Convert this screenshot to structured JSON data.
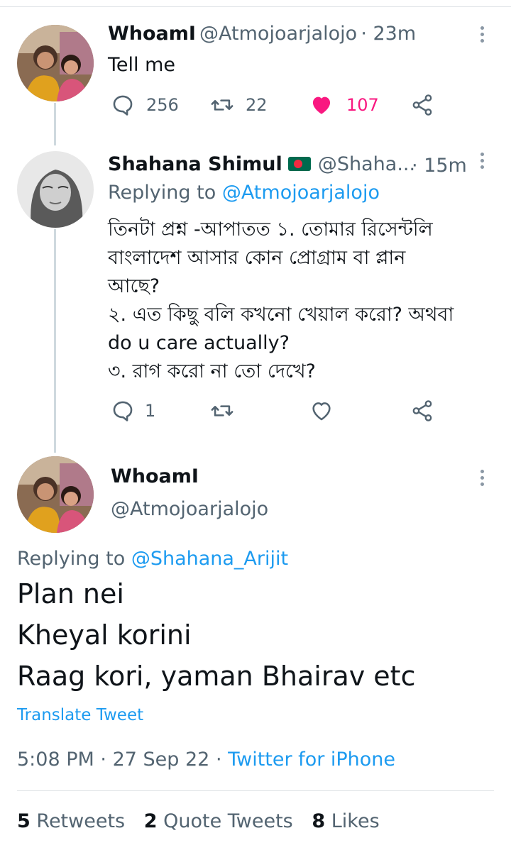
{
  "tweet1": {
    "name": "WhoamI",
    "handle": "@Atmojoarjalojo",
    "time": "· 23m",
    "text": "Tell me",
    "replies": "256",
    "retweets": "22",
    "likes": "107"
  },
  "tweet2": {
    "name": "Shahana Shimul",
    "handle": "@Shaha...",
    "time": "· 15m",
    "replying_prefix": "Replying to",
    "replying_handle": "@Atmojoarjalojo",
    "lines": [
      "তিনটা  প্রশ্ন -আপাতত ১. তোমার রিসেন্টলি",
      "বাংলাদেশ আসার কোন প্রোগ্রাম বা প্লান",
      "আছে?",
      "২. এত কিছু বলি কখনো খেয়াল করো? অথবা",
      "do u care actually?",
      "৩. রাগ করো না তো দেখে?"
    ],
    "replies": "1"
  },
  "main_tweet": {
    "name": "WhoamI",
    "handle": "@Atmojoarjalojo",
    "replying_prefix": "Replying to",
    "replying_handle": "@Shahana_Arijit",
    "lines": [
      "Plan nei",
      "Kheyal korini",
      "Raag kori, yaman Bhairav etc"
    ],
    "translate": "Translate Tweet",
    "time": "5:08 PM",
    "date": "27 Sep 22",
    "source": "Twitter for iPhone",
    "retweets_count": "5",
    "retweets_label": "Retweets",
    "quotes_count": "2",
    "quotes_label": "Quote Tweets",
    "likes_count": "8",
    "likes_label": "Likes"
  },
  "colors": {
    "accent": "#1d9bf0",
    "like": "#f91880",
    "muted": "#536471"
  }
}
